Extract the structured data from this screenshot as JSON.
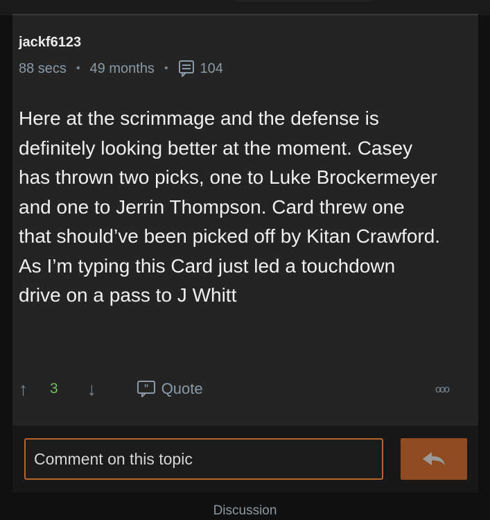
{
  "post": {
    "username": "jackf6123",
    "meta": {
      "reading_time": "88 secs",
      "age": "49 months",
      "reply_count": "104",
      "reply_icon": "comment-list-icon"
    },
    "body": "Here at the scrimmage and the defense is definitely looking better at the moment. Casey has thrown two picks, one to Luke Brockermeyer and one to Jerrin Thompson. Card threw one that should’ve been picked off by Kitan Crawford. As I’m typing this Card just led a touchdown drive on a pass to J Whitt"
  },
  "actions": {
    "upvote_icon": "arrow-up-icon",
    "score": "3",
    "downvote_icon": "arrow-down-icon",
    "quote_label": "Quote",
    "quote_icon": "quote-bubble-icon",
    "more_icon": "ooo"
  },
  "composer": {
    "placeholder": "Comment on this topic",
    "send_icon": "reply-arrow-icon",
    "accent_color": "#b8642a",
    "button_color": "#8f4b21"
  },
  "footer": {
    "tab_label": "Discussion"
  }
}
